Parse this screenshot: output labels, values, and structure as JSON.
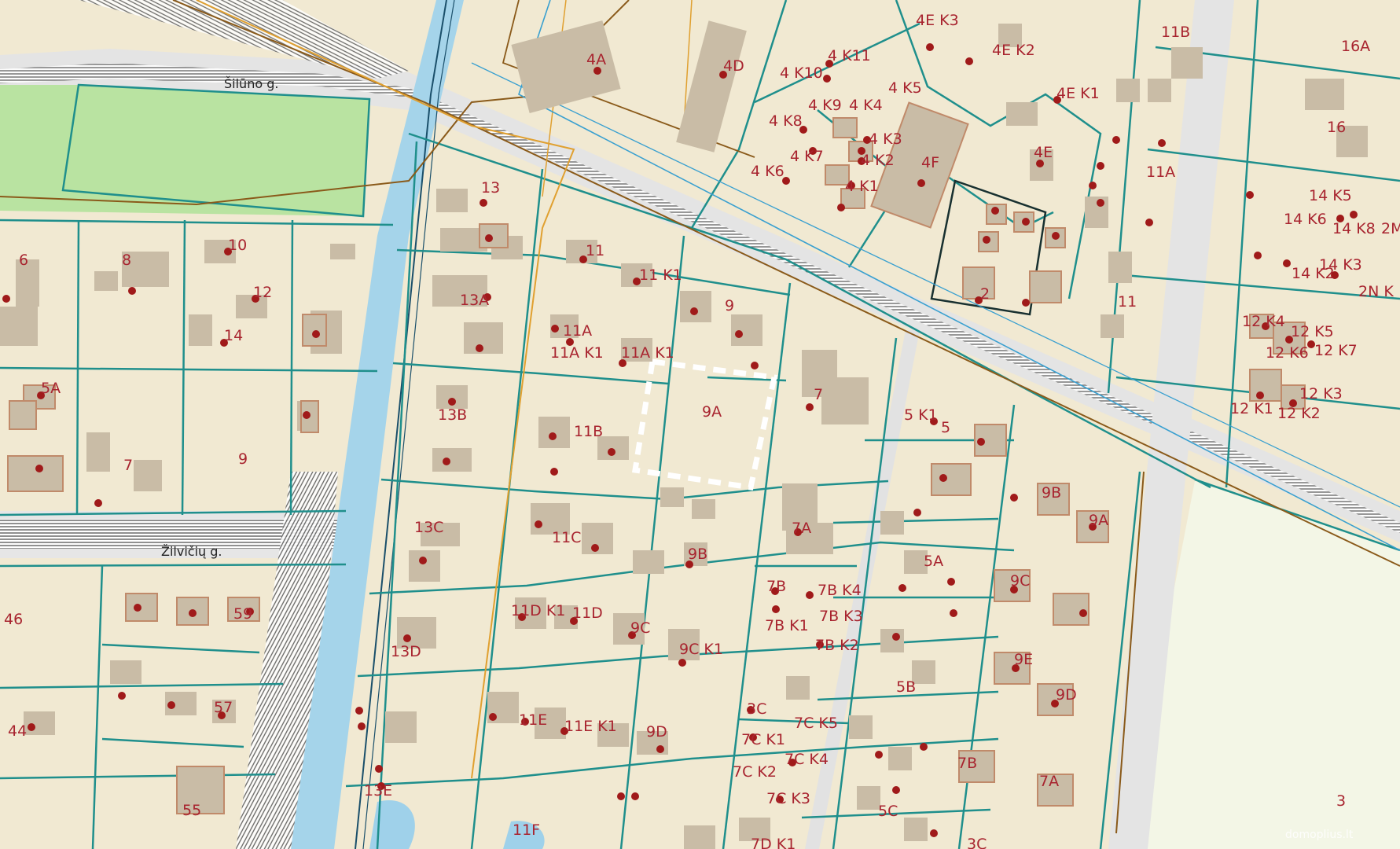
{
  "colors": {
    "ground": "#f1e9d2",
    "park": "#b9e3a1",
    "parcel_border": "#1f8f8c",
    "building": "#c9bca6",
    "building_outline": "#c08a6a",
    "water": "#9fd1ea",
    "road_hatch": "#6b6b6b",
    "utility_orange": "#e0a030",
    "utility_brown": "#8a5a1a",
    "label": "#a8242f",
    "selection": "#ffffff"
  },
  "streets": [
    "Šilūno g.",
    "Žilvičių g."
  ],
  "selected_parcel": "9A",
  "parcel_labels": [
    "4E K3",
    "4E K2",
    "11B",
    "16A",
    "4A",
    "4D",
    "4 K11",
    "4 K10",
    "4 K5",
    "4E K1",
    "4 K9",
    "4 K4",
    "4 K8",
    "4 K3",
    "4 K7",
    "4 K2",
    "4 K6",
    "4 K1",
    "4F",
    "4E",
    "16",
    "11A",
    "13",
    "14 K5",
    "14 K6",
    "14 K8",
    "2M",
    "10",
    "6",
    "8",
    "11",
    "11 K1",
    "12",
    "14",
    "2",
    "14 K2",
    "14 K3",
    "2N K",
    "13A",
    "9",
    "11A",
    "11A K1",
    "11A K1",
    "11",
    "12 K4",
    "12 K5",
    "12 K6",
    "12 K7",
    "5A",
    "13B",
    "11B",
    "7",
    "12 K1",
    "12 K2",
    "12 K3",
    "5 K1",
    "5",
    "7",
    "9",
    "9B",
    "9A",
    "13C",
    "11C",
    "7A",
    "5A",
    "9B",
    "7B",
    "7B K4",
    "9C",
    "46",
    "59",
    "11D K1",
    "11D",
    "7B K1",
    "7B K3",
    "9C",
    "9C K1",
    "7B K2",
    "13D",
    "5B",
    "9E",
    "9D",
    "57",
    "44",
    "3C",
    "11E",
    "11E K1",
    "9D",
    "7C K5",
    "7C K1",
    "7C K4",
    "7C K2",
    "7B",
    "7A",
    "13E",
    "7C K3",
    "5C",
    "55",
    "11F",
    "3",
    "7D K1",
    "3C"
  ],
  "watermark": "domoplius.lt"
}
